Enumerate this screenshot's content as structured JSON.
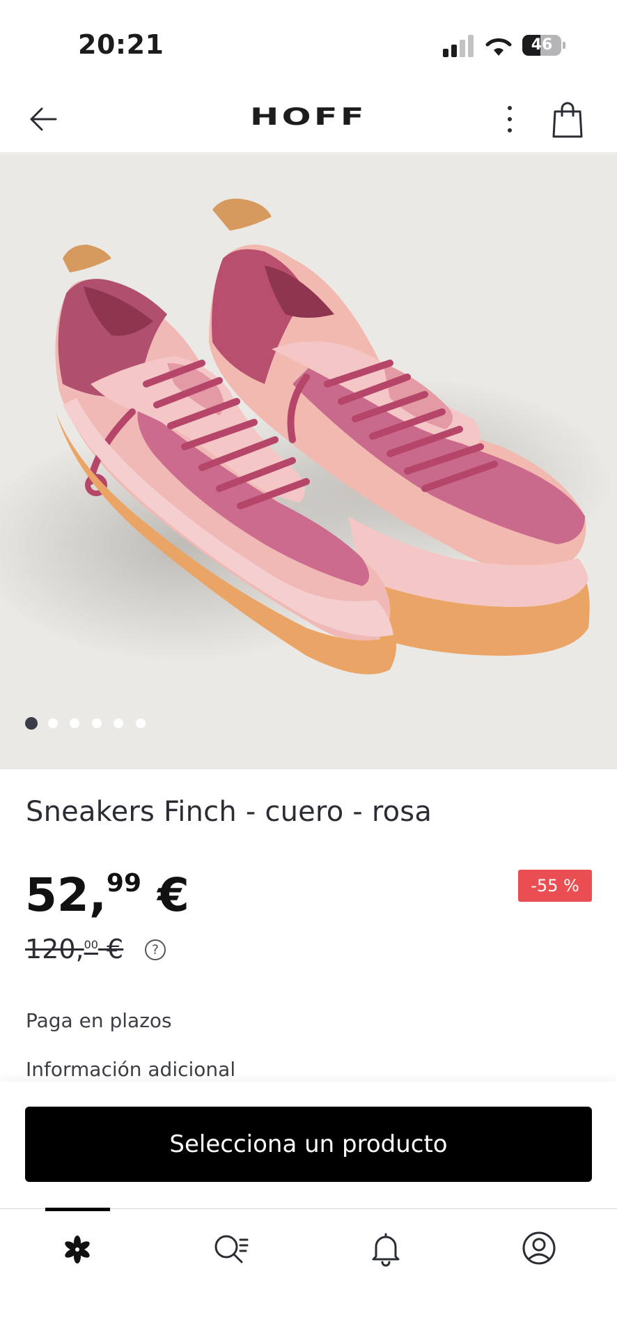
{
  "status_bar": {
    "time": "20:21",
    "battery": "46",
    "battery_level": 0.46
  },
  "header": {
    "logo": "HOFF",
    "icons": [
      "back-arrow-icon",
      "more-vertical-icon",
      "shopping-bag-icon"
    ]
  },
  "gallery": {
    "image_description_icon": "sneakers-photo",
    "total_images": 6,
    "active_index": 0
  },
  "product": {
    "title": "Sneakers Finch - cuero - rosa",
    "price_whole": "52,",
    "price_cents": "99",
    "price_currency": " €",
    "old_price_whole": "120,",
    "old_price_cents": "00",
    "old_price_currency": " €",
    "discount": "-55 %",
    "help_symbol": "?"
  },
  "links": {
    "installments": "Paga en plazos",
    "additional_info": "Información adicional"
  },
  "cta": {
    "label": "Selecciona un producto"
  },
  "bottom_nav": {
    "items": [
      "home-flower-icon",
      "search-list-icon",
      "bell-icon",
      "account-icon"
    ],
    "active": 0
  },
  "colors": {
    "accent_discount": "#e94f52",
    "cta_background": "#000000",
    "image_background": "#ebe9e5"
  }
}
